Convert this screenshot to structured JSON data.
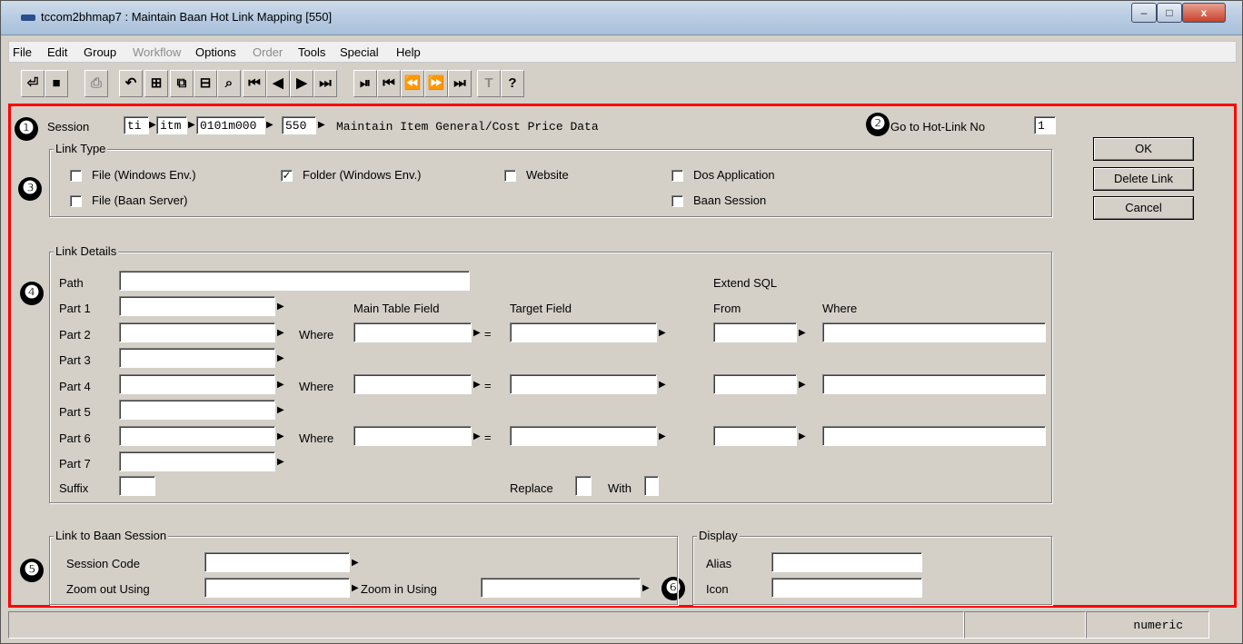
{
  "window": {
    "title": "tccom2bhmap7 : Maintain Baan Hot Link Mapping [550]"
  },
  "menu": [
    "File",
    "Edit",
    "Group",
    "Workflow",
    "Options",
    "Order",
    "Tools",
    "Special",
    "Help"
  ],
  "menu_disabled": [
    "Workflow",
    "Order"
  ],
  "toolbar": [
    {
      "icon": "exit-icon",
      "glyph": "⏎"
    },
    {
      "icon": "save-icon",
      "glyph": "■"
    },
    {
      "icon": "print-icon",
      "glyph": "⎙"
    },
    {
      "icon": "undo-icon",
      "glyph": "↶"
    },
    {
      "icon": "insert-record-icon",
      "glyph": "⊞"
    },
    {
      "icon": "copy-icon",
      "glyph": "⧉"
    },
    {
      "icon": "delete-record-icon",
      "glyph": "⊟"
    },
    {
      "icon": "find-icon",
      "glyph": "⌕"
    },
    {
      "icon": "first-record-icon",
      "glyph": "⏮"
    },
    {
      "icon": "previous-record-icon",
      "glyph": "◀"
    },
    {
      "icon": "next-record-icon",
      "glyph": "▶"
    },
    {
      "icon": "last-record-icon",
      "glyph": "⏭"
    },
    {
      "icon": "first-set-icon",
      "glyph": "⏯"
    },
    {
      "icon": "first-page-icon",
      "glyph": "⏮"
    },
    {
      "icon": "previous-page-icon",
      "glyph": "⏪"
    },
    {
      "icon": "next-page-icon",
      "glyph": "⏩"
    },
    {
      "icon": "last-page-icon",
      "glyph": "⏭"
    },
    {
      "icon": "text-icon",
      "glyph": "T"
    },
    {
      "icon": "help-pointer-icon",
      "glyph": "?"
    }
  ],
  "session": {
    "label": "Session",
    "package": "ti",
    "module": "itm",
    "code": "0101m000",
    "number": "550",
    "description": "Maintain Item General/Cost Price Data"
  },
  "goto": {
    "label": "Go to Hot-Link No",
    "value": "1"
  },
  "buttons": {
    "ok": "OK",
    "delete": "Delete Link",
    "cancel": "Cancel"
  },
  "link_type": {
    "caption": "Link Type",
    "file_windows": "File (Windows Env.)",
    "file_windows_checked": false,
    "folder_windows": "Folder (Windows Env.)",
    "folder_windows_checked": true,
    "website": "Website",
    "website_checked": false,
    "dos_app": "Dos Application",
    "dos_app_checked": false,
    "file_server": "File (Baan Server)",
    "file_server_checked": false,
    "baan_session": "Baan Session",
    "baan_session_checked": false
  },
  "link_details": {
    "caption": "Link Details",
    "path": "Path",
    "extend_sql": "Extend SQL",
    "part1": "Part 1",
    "part2": "Part 2",
    "part3": "Part 3",
    "part4": "Part 4",
    "part5": "Part 5",
    "part6": "Part 6",
    "part7": "Part 7",
    "main_table_field": "Main Table Field",
    "target_field": "Target Field",
    "from": "From",
    "where": "Where",
    "where_row": "Where",
    "equals": "=",
    "suffix": "Suffix",
    "replace": "Replace",
    "with": "With"
  },
  "baan_session": {
    "caption": "Link to Baan Session",
    "session_code": "Session Code",
    "zoom_out": "Zoom out Using",
    "zoom_in": "Zoom in Using"
  },
  "display": {
    "caption": "Display",
    "alias": "Alias",
    "icon": "Icon"
  },
  "status": {
    "mode": "numeric"
  },
  "markers": [
    "❶",
    "❷",
    "❸",
    "❹",
    "❺",
    "❻"
  ]
}
